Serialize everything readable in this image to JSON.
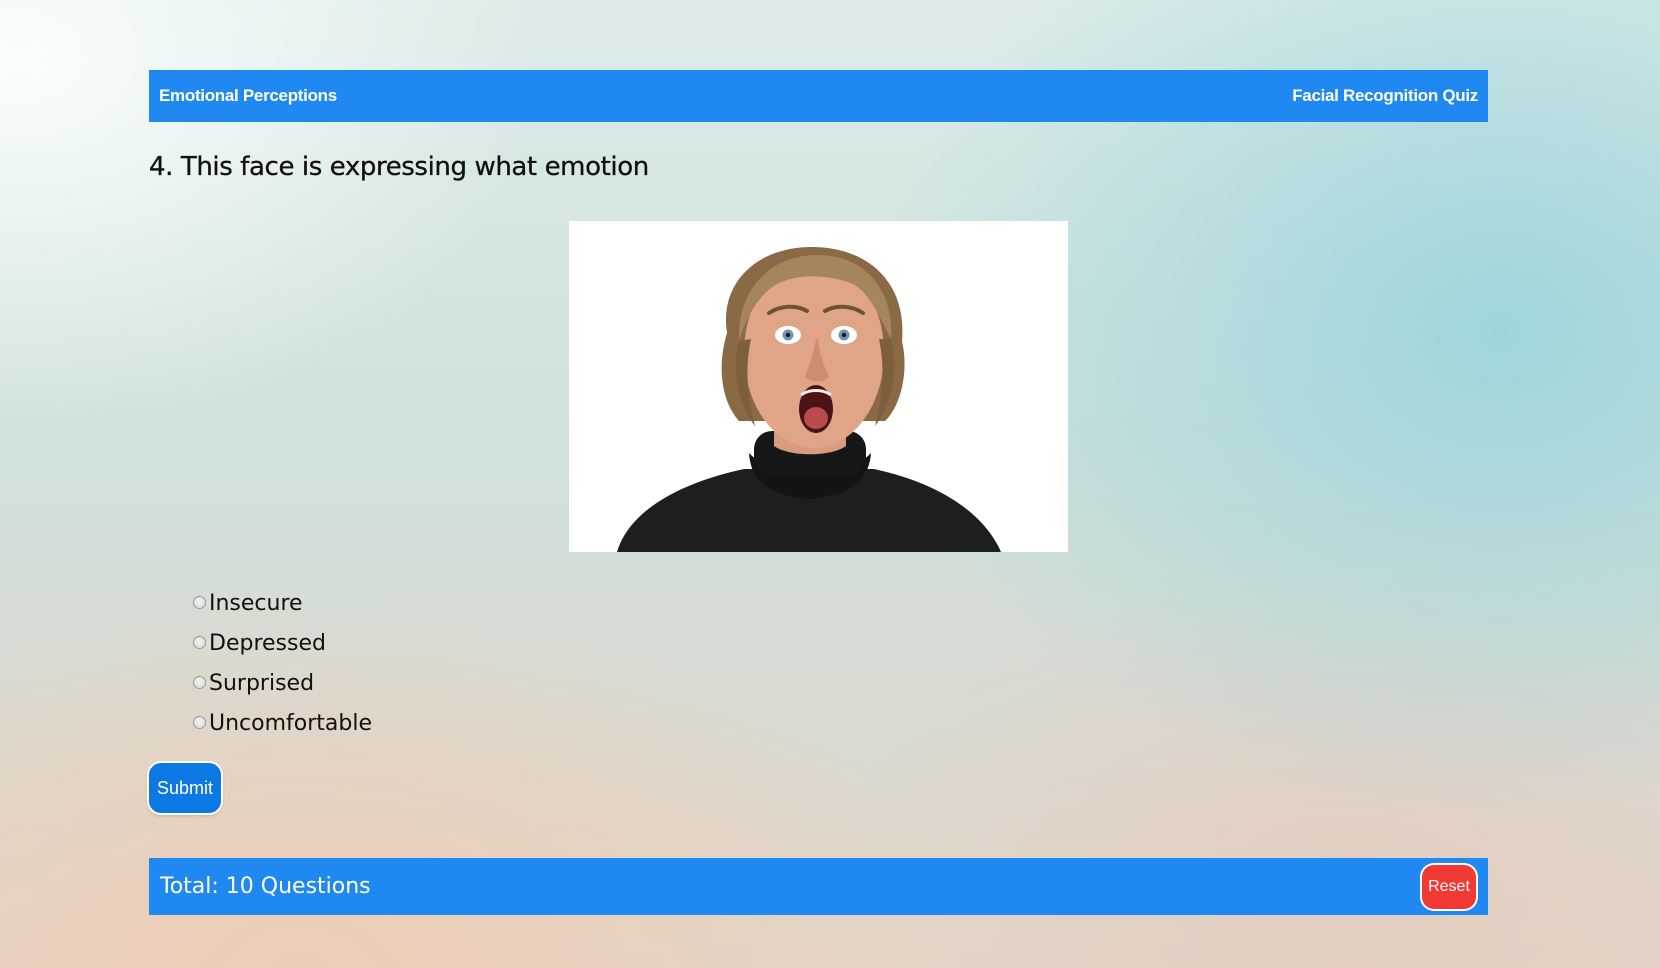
{
  "header": {
    "site_title": "Emotional Perceptions",
    "quiz_title": "Facial Recognition Quiz"
  },
  "question": {
    "title": "4. This face is expressing what emotion",
    "image_alt": "",
    "options": [
      "Insecure",
      "Depressed",
      "Surprised",
      "Uncomfortable"
    ],
    "selected": null
  },
  "actions": {
    "submit_label": "Submit",
    "reset_label": "Reset"
  },
  "footer": {
    "total_text": "Total: 10 Questions"
  },
  "colors": {
    "bar": "#2089f1",
    "submit": "#0b78e3",
    "reset": "#f03a33"
  }
}
